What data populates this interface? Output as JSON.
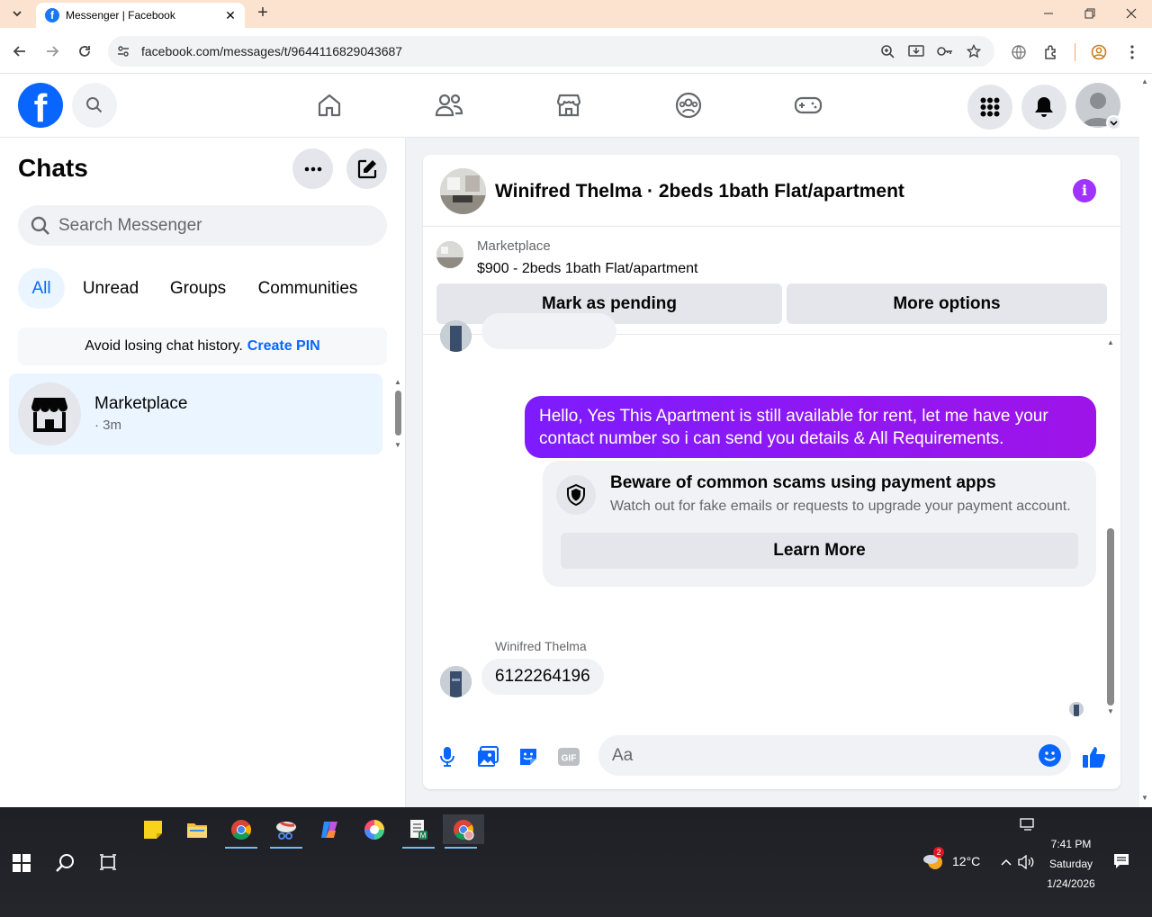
{
  "browser": {
    "tab_title": "Messenger | Facebook",
    "url": "facebook.com/messages/t/9644116829043687"
  },
  "fb": {
    "logo_letter": "f"
  },
  "chats": {
    "title": "Chats",
    "search_placeholder": "Search Messenger",
    "filters": [
      "All",
      "Unread",
      "Groups",
      "Communities"
    ],
    "pin_banner_text": "Avoid losing chat history.",
    "pin_banner_link": "Create PIN",
    "items": [
      {
        "name": "Marketplace",
        "time": "· 3m"
      }
    ]
  },
  "conversation": {
    "title": "Winifred Thelma · 2beds 1bath Flat/apartment",
    "marketplace_label": "Marketplace",
    "listing": "$900 - 2beds 1bath Flat/apartment",
    "mark_pending_label": "Mark as pending",
    "more_options_label": "More options",
    "outgoing_message": "Hello, Yes This Apartment is still available for rent, let me have your contact number so i can send you details & All Requirements.",
    "scam_title": "Beware of common scams using payment apps",
    "scam_desc": "Watch out for fake emails or requests to upgrade your payment account.",
    "scam_button": "Learn More",
    "sender_name": "Winifred Thelma",
    "incoming_message": "6122264196",
    "composer_placeholder": "Aa"
  },
  "taskbar": {
    "weather_temp": "12°C",
    "weather_badge": "2",
    "time": "7:41 PM",
    "day": "Saturday",
    "date": "1/24/2026"
  },
  "colors": {
    "accent": "#0866ff",
    "outgoing_bubble": "#8a15ff",
    "tabbar": "#fbe3cf"
  }
}
